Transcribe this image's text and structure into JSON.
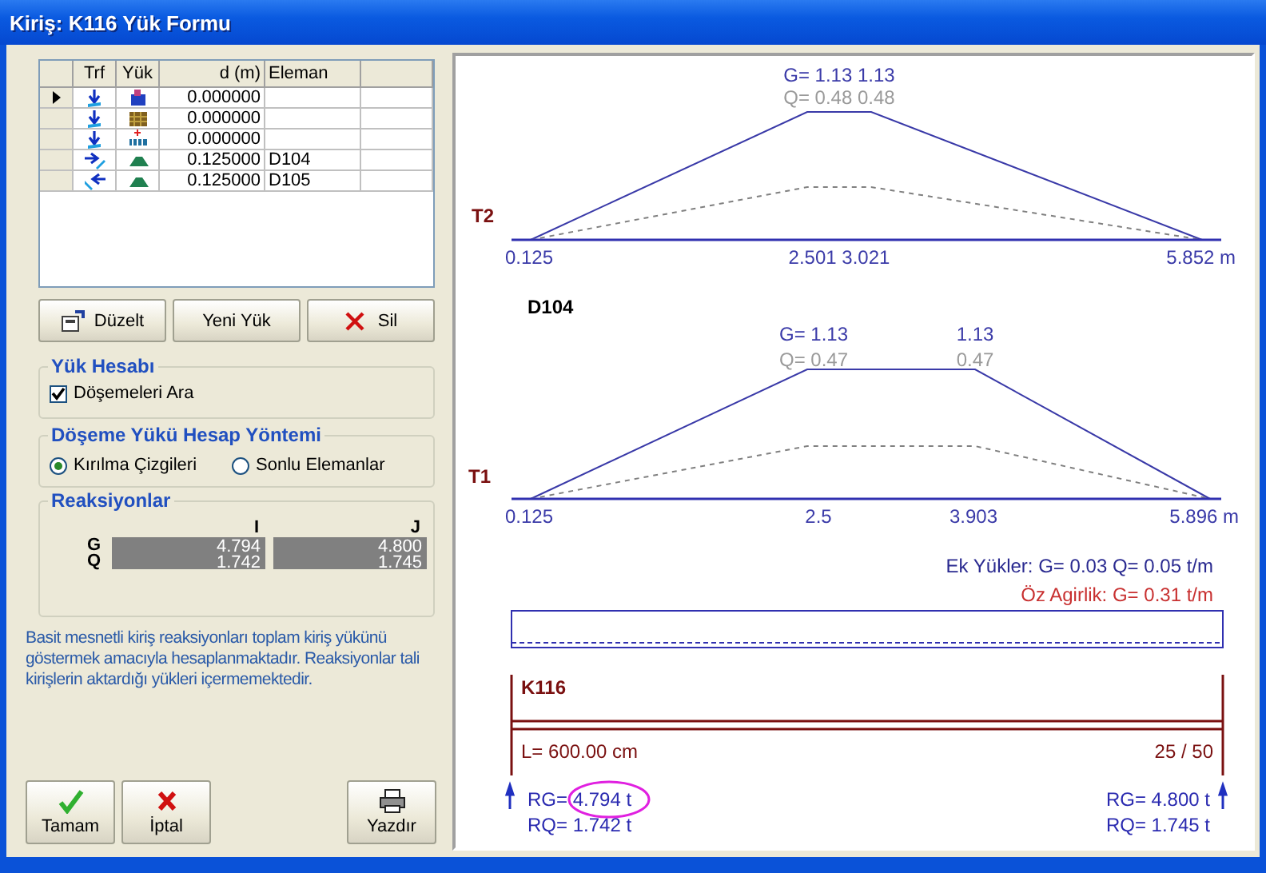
{
  "window": {
    "title": "Kiriş: K116 Yük Formu"
  },
  "load_table": {
    "columns": [
      "Trf",
      "Yük",
      "d (m)",
      "Eleman"
    ],
    "rows": [
      {
        "selected": true,
        "d": "0.000000"
      },
      {
        "selected": false,
        "d": "0.000000"
      },
      {
        "selected": false,
        "d": "0.000000"
      },
      {
        "selected": false,
        "d": "0.125000",
        "element": "D104"
      },
      {
        "selected": false,
        "d": "0.125000",
        "element": "D105"
      }
    ]
  },
  "table_buttons": [
    "Düzelt",
    "Yeni Yük",
    "Sil"
  ],
  "load_calc": {
    "title": "Yük Hesabı",
    "checkbox": {
      "label": "Döşemeleri Ara",
      "checked": true
    }
  },
  "method": {
    "title": "Döşeme Yükü Hesap Yöntemi",
    "options": [
      {
        "label": "Kırılma Çizgileri",
        "selected": true
      },
      {
        "label": "Sonlu Elemanlar",
        "selected": false
      }
    ]
  },
  "reactions": {
    "title": "Reaksiyonlar",
    "columns": [
      "I",
      "J"
    ],
    "row_labels": [
      "G",
      "Q"
    ],
    "cells": [
      [
        "4.794",
        "1.742"
      ],
      [
        "4.800",
        "1.745"
      ]
    ]
  },
  "note": "Basit mesnetli kiriş reaksiyonları toplam kiriş yükünü göstermek amacıyla hesaplanmaktadır. Reaksiyonlar tali kirişlerin aktardığı yükleri içermemektedir.",
  "dialog_buttons": [
    "Tamam",
    "İptal",
    "Yazdır"
  ],
  "diagram": {
    "loads": [
      {
        "tag": "T2",
        "g_labels": [
          "G= 1.13 1.13"
        ],
        "q_labels": [
          "Q= 0.48 0.48"
        ],
        "positions": [
          "0.125",
          "2.501  3.021",
          "5.852 m"
        ]
      },
      {
        "element": "D104",
        "tag": "T1",
        "g_labels": [
          "G= 1.13",
          "1.13"
        ],
        "q_labels": [
          "Q= 0.47",
          "0.47"
        ],
        "positions": [
          "0.125",
          "2.5",
          "3.903",
          "5.896 m"
        ]
      }
    ],
    "extra_loads": "Ek Yükler: G= 0.03  Q= 0.05 t/m",
    "self_weight": "Öz Agirlik: G= 0.31 t/m",
    "beam": {
      "name": "K116",
      "length": "L= 600.00 cm",
      "section": "25 / 50"
    },
    "support_reactions": {
      "left": [
        "RG= 4.794 t",
        "RQ= 1.742 t"
      ],
      "right": [
        "RG= 4.800 t",
        "RQ= 1.745 t"
      ]
    }
  }
}
